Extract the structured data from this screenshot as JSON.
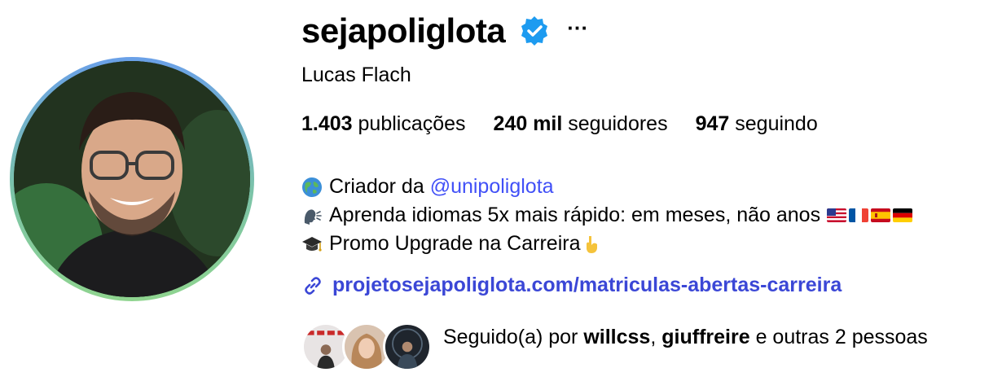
{
  "profile": {
    "username": "sejapoliglota",
    "full_name": "Lucas Flach",
    "verified": true
  },
  "stats": {
    "posts_count": "1.403",
    "posts_label": "publicações",
    "followers_count": "240 mil",
    "followers_label": "seguidores",
    "following_count": "947",
    "following_label": "seguindo"
  },
  "bio": {
    "line1_prefix": "Criador da",
    "line1_mention": "@unipoliglota",
    "line2": "Aprenda idiomas 5x mais rápido: em meses, não anos",
    "line3": "Promo Upgrade na Carreira"
  },
  "link": {
    "text": "projetosejapoliglota.com/matriculas-abertas-carreira"
  },
  "followed_by": {
    "prefix": "Seguido(a) por",
    "user1": "willcss",
    "separator": ",",
    "user2": "giuffreire",
    "suffix": "e outras 2 pessoas"
  },
  "colors": {
    "mention": "#4150f7",
    "link": "#3b47d6",
    "verified": "#1d9bf0"
  },
  "icons": {
    "bio_line1": "globe-icon",
    "bio_line2": "speaking-head-icon",
    "bio_line3": "graduation-cap-icon",
    "bio_end": "pointing-down-icon",
    "link": "link-icon"
  }
}
